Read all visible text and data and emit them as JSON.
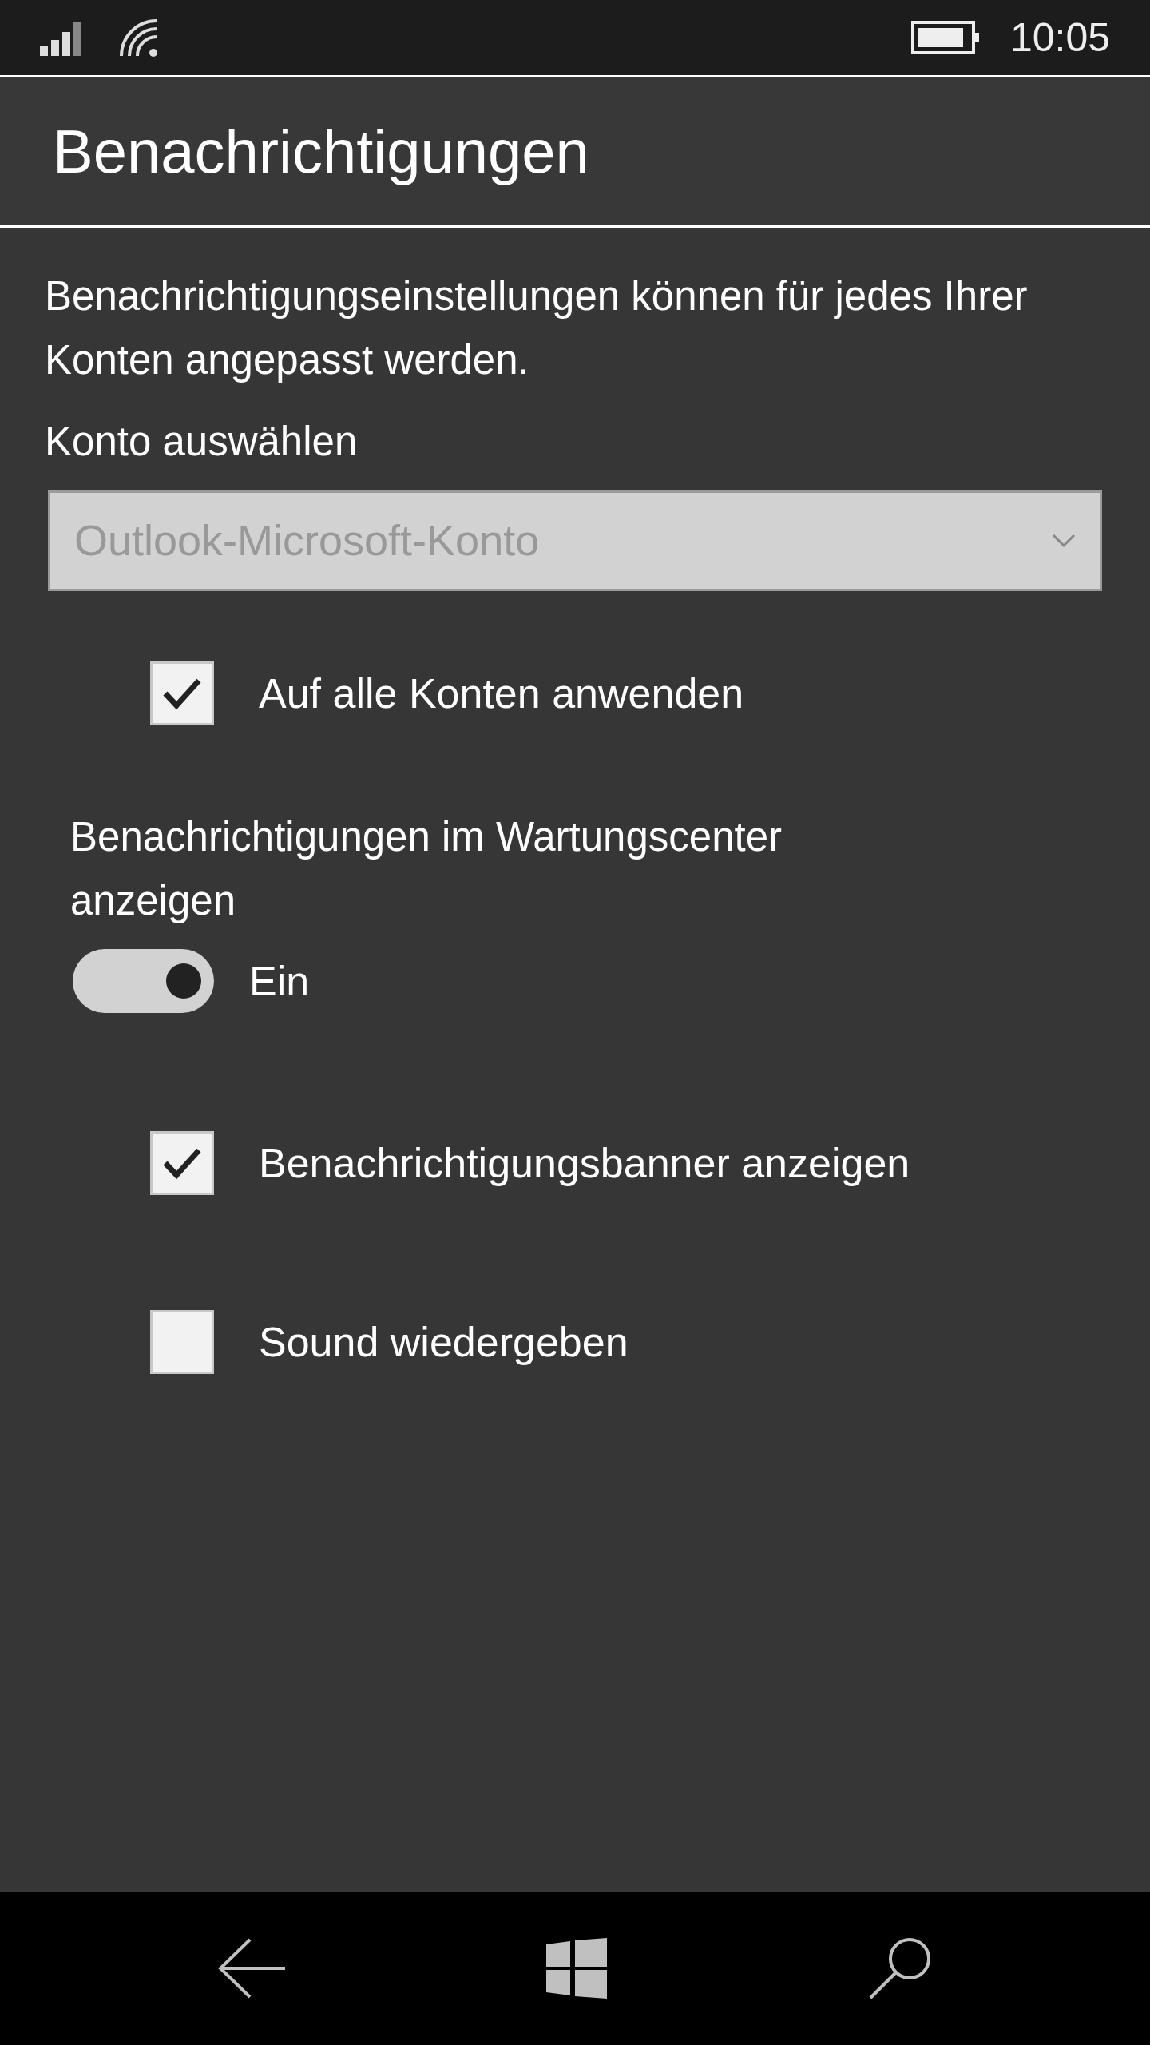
{
  "status_bar": {
    "time": "10:05"
  },
  "header": {
    "title": "Benachrichtigungen"
  },
  "description": "Benachrichtigungseinstellungen können für jedes Ihrer Konten angepasst werden.",
  "account": {
    "label": "Konto auswählen",
    "value": "Outlook-Microsoft-Konto",
    "disabled": true
  },
  "apply_all": {
    "label": "Auf alle Konten anwenden",
    "checked": true
  },
  "action_center": {
    "label": "Benachrichtigungen im Wartungscenter anzeigen",
    "on": true,
    "state_text": "Ein"
  },
  "options": [
    {
      "label": "Benachrichtigungsbanner anzeigen",
      "checked": true
    },
    {
      "label": "Sound wiedergeben",
      "checked": false
    }
  ]
}
